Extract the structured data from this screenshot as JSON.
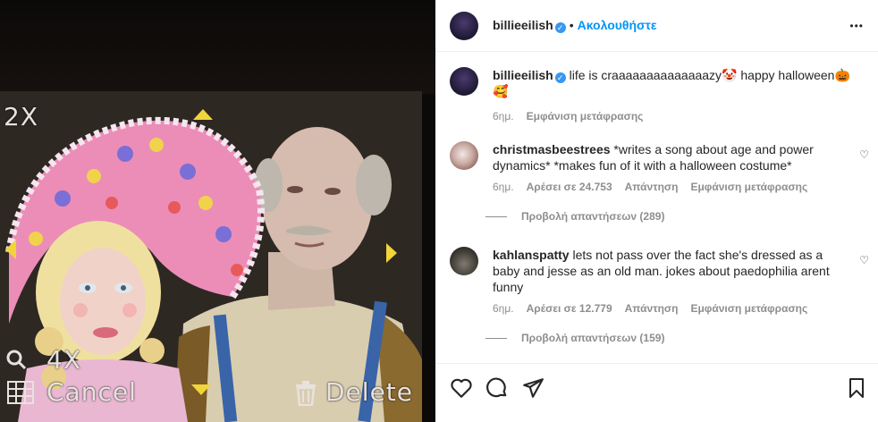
{
  "media": {
    "overlay": {
      "zoom_top": "2X",
      "zoom_bottom": "4X",
      "cancel": "Cancel",
      "delete": "Delete"
    }
  },
  "header": {
    "username": "billieeilish",
    "separator": "•",
    "follow_label": "Ακολουθήστε",
    "more_label": "•••"
  },
  "caption": {
    "username": "billieeilish",
    "text": "life is craaaaaaaaaaaaaazy🤡 happy halloween🎃🥰",
    "time": "6ημ.",
    "translate": "Εμφάνιση μετάφρασης"
  },
  "comments": [
    {
      "username": "christmasbeestrees",
      "text": "*writes a song about age and power dynamics* *makes fun of it with a halloween costume*",
      "time": "6ημ.",
      "likes": "Αρέσει σε 24.753",
      "reply": "Απάντηση",
      "translate": "Εμφάνιση μετάφρασης",
      "view_replies": "Προβολή απαντήσεων (289)"
    },
    {
      "username": "kahlanspatty",
      "text": "lets not pass over the fact she's dressed as a baby and jesse as an old man. jokes about paedophilia arent funny",
      "time": "6ημ.",
      "likes": "Αρέσει σε 12.779",
      "reply": "Απάντηση",
      "translate": "Εμφάνιση μετάφρασης",
      "view_replies": "Προβολή απαντήσεων (159)"
    }
  ],
  "colors": {
    "accent": "#0095f6",
    "verified": "#3897f0",
    "muted": "#8e8e8e"
  },
  "icons": [
    "heart-icon",
    "comment-icon",
    "share-icon",
    "bookmark-icon",
    "more-icon",
    "verified-icon"
  ]
}
